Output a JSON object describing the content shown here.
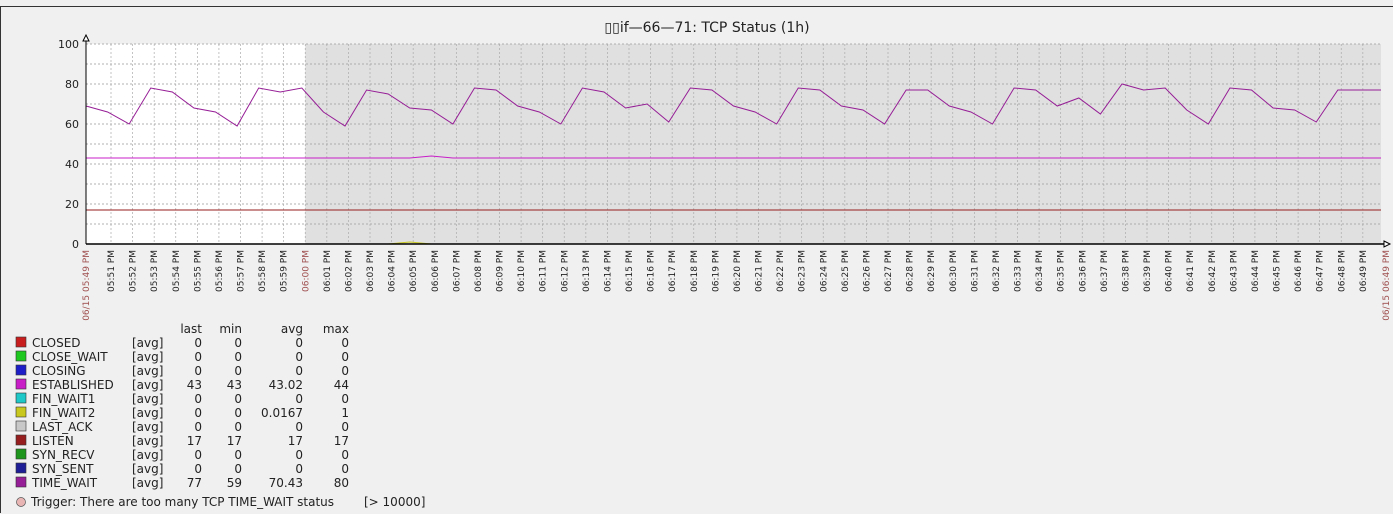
{
  "chart_data": {
    "type": "line",
    "title": "▯▯if—66—71: TCP Status (1h)",
    "ylim": [
      0,
      100
    ],
    "yticks": [
      0,
      20,
      40,
      60,
      80,
      100
    ],
    "grid": true,
    "x_start_label": "06/15 05:49 PM",
    "x_end_label": "06/15 06:49 PM",
    "x_ticks": [
      "05:51 PM",
      "05:52 PM",
      "05:53 PM",
      "05:54 PM",
      "05:55 PM",
      "05:56 PM",
      "05:57 PM",
      "05:58 PM",
      "05:59 PM",
      "06:00 PM",
      "06:01 PM",
      "06:02 PM",
      "06:03 PM",
      "06:04 PM",
      "06:05 PM",
      "06:06 PM",
      "06:07 PM",
      "06:08 PM",
      "06:09 PM",
      "06:10 PM",
      "06:11 PM",
      "06:12 PM",
      "06:13 PM",
      "06:14 PM",
      "06:15 PM",
      "06:16 PM",
      "06:17 PM",
      "06:18 PM",
      "06:19 PM",
      "06:20 PM",
      "06:21 PM",
      "06:22 PM",
      "06:23 PM",
      "06:24 PM",
      "06:25 PM",
      "06:26 PM",
      "06:27 PM",
      "06:28 PM",
      "06:29 PM",
      "06:30 PM",
      "06:31 PM",
      "06:32 PM",
      "06:33 PM",
      "06:34 PM",
      "06:35 PM",
      "06:36 PM",
      "06:37 PM",
      "06:38 PM",
      "06:39 PM",
      "06:40 PM",
      "06:41 PM",
      "06:42 PM",
      "06:43 PM",
      "06:44 PM",
      "06:45 PM",
      "06:46 PM",
      "06:47 PM",
      "06:48 PM",
      "06:49 PM"
    ],
    "highlight_tick": "06:00 PM",
    "colors": {
      "background": "#f0f0f0",
      "plot_light": "#ffffff",
      "plot_shaded": "#e0e0e0",
      "highlight_label": "#a05050"
    },
    "legend_headers": [
      "last",
      "min",
      "avg",
      "max"
    ],
    "series": [
      {
        "name": "CLOSED",
        "color": "#c81e1e",
        "func": "[avg]",
        "last": "0",
        "min": "0",
        "avg": "0",
        "max": "0",
        "values": [
          0
        ]
      },
      {
        "name": "CLOSE_WAIT",
        "color": "#1ec81e",
        "func": "[avg]",
        "last": "0",
        "min": "0",
        "avg": "0",
        "max": "0",
        "values": [
          0
        ]
      },
      {
        "name": "CLOSING",
        "color": "#1e1ec8",
        "func": "[avg]",
        "last": "0",
        "min": "0",
        "avg": "0",
        "max": "0",
        "values": [
          0
        ]
      },
      {
        "name": "ESTABLISHED",
        "color": "#c81ec8",
        "func": "[avg]",
        "last": "43",
        "min": "43",
        "avg": "43.02",
        "max": "44",
        "values": [
          43,
          43,
          43,
          43,
          43,
          43,
          43,
          43,
          43,
          43,
          43,
          43,
          43,
          43,
          43,
          43,
          44,
          43,
          43,
          43,
          43,
          43,
          43,
          43,
          43,
          43,
          43,
          43,
          43,
          43,
          43,
          43,
          43,
          43,
          43,
          43,
          43,
          43,
          43,
          43,
          43,
          43,
          43,
          43,
          43,
          43,
          43,
          43,
          43,
          43,
          43,
          43,
          43,
          43,
          43,
          43,
          43,
          43,
          43,
          43,
          43
        ]
      },
      {
        "name": "FIN_WAIT1",
        "color": "#1ec8c8",
        "func": "[avg]",
        "last": "0",
        "min": "0",
        "avg": "0",
        "max": "0",
        "values": [
          0
        ]
      },
      {
        "name": "FIN_WAIT2",
        "color": "#c8c81e",
        "func": "[avg]",
        "last": "0",
        "min": "0",
        "avg": "0.0167",
        "max": "1",
        "values": [
          0,
          0,
          0,
          0,
          0,
          0,
          0,
          0,
          0,
          0,
          0,
          0,
          0,
          0,
          0,
          1,
          0,
          0,
          0,
          0,
          0,
          0,
          0,
          0,
          0,
          0,
          0,
          0,
          0,
          0,
          0,
          0,
          0,
          0,
          0,
          0,
          0,
          0,
          0,
          0,
          0,
          0,
          0,
          0,
          0,
          0,
          0,
          0,
          0,
          0,
          0,
          0,
          0,
          0,
          0,
          0,
          0,
          0,
          0,
          0,
          0
        ]
      },
      {
        "name": "LAST_ACK",
        "color": "#c8c8c8",
        "func": "[avg]",
        "last": "0",
        "min": "0",
        "avg": "0",
        "max": "0",
        "values": [
          0
        ]
      },
      {
        "name": "LISTEN",
        "color": "#961e1e",
        "func": "[avg]",
        "last": "17",
        "min": "17",
        "avg": "17",
        "max": "17",
        "values": [
          17
        ]
      },
      {
        "name": "SYN_RECV",
        "color": "#1e961e",
        "func": "[avg]",
        "last": "0",
        "min": "0",
        "avg": "0",
        "max": "0",
        "values": [
          0
        ]
      },
      {
        "name": "SYN_SENT",
        "color": "#1e1e96",
        "func": "[avg]",
        "last": "0",
        "min": "0",
        "avg": "0",
        "max": "0",
        "values": [
          0
        ]
      },
      {
        "name": "TIME_WAIT",
        "color": "#961e96",
        "func": "[avg]",
        "last": "77",
        "min": "59",
        "avg": "70.43",
        "max": "80",
        "values": [
          69,
          66,
          60,
          78,
          76,
          68,
          66,
          59,
          78,
          76,
          78,
          66,
          59,
          77,
          75,
          68,
          67,
          60,
          78,
          77,
          69,
          66,
          60,
          78,
          76,
          68,
          70,
          61,
          78,
          77,
          69,
          66,
          60,
          78,
          77,
          69,
          67,
          60,
          77,
          77,
          69,
          66,
          60,
          78,
          77,
          69,
          73,
          65,
          80,
          77,
          78,
          67,
          60,
          78,
          77,
          68,
          67,
          61,
          77,
          77,
          77
        ]
      }
    ],
    "trigger": {
      "label": "Trigger: There are too many TCP TIME_WAIT status",
      "threshold": "[> 10000]",
      "color": "#e8b4b4"
    }
  }
}
